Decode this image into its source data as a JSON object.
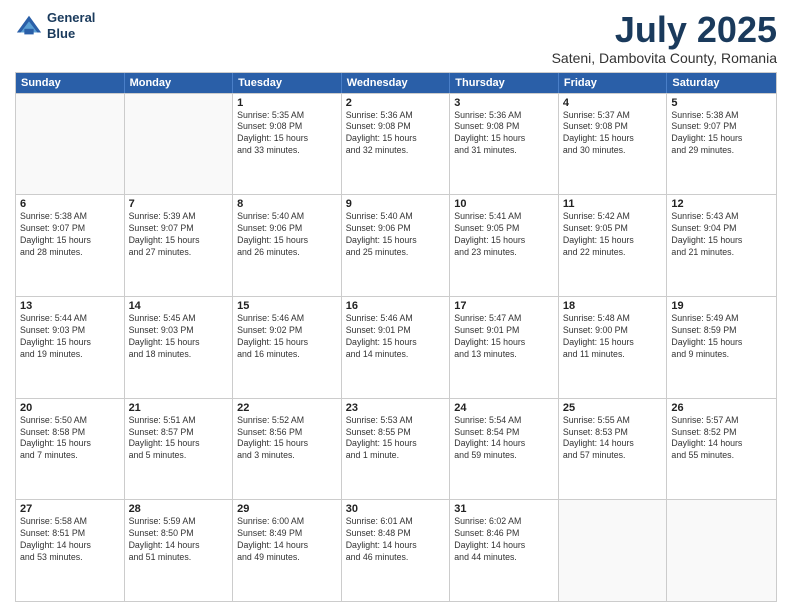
{
  "header": {
    "logo_line1": "General",
    "logo_line2": "Blue",
    "title": "July 2025",
    "subtitle": "Sateni, Dambovita County, Romania"
  },
  "days_of_week": [
    "Sunday",
    "Monday",
    "Tuesday",
    "Wednesday",
    "Thursday",
    "Friday",
    "Saturday"
  ],
  "weeks": [
    [
      {
        "day": "",
        "info": ""
      },
      {
        "day": "",
        "info": ""
      },
      {
        "day": "1",
        "info": "Sunrise: 5:35 AM\nSunset: 9:08 PM\nDaylight: 15 hours\nand 33 minutes."
      },
      {
        "day": "2",
        "info": "Sunrise: 5:36 AM\nSunset: 9:08 PM\nDaylight: 15 hours\nand 32 minutes."
      },
      {
        "day": "3",
        "info": "Sunrise: 5:36 AM\nSunset: 9:08 PM\nDaylight: 15 hours\nand 31 minutes."
      },
      {
        "day": "4",
        "info": "Sunrise: 5:37 AM\nSunset: 9:08 PM\nDaylight: 15 hours\nand 30 minutes."
      },
      {
        "day": "5",
        "info": "Sunrise: 5:38 AM\nSunset: 9:07 PM\nDaylight: 15 hours\nand 29 minutes."
      }
    ],
    [
      {
        "day": "6",
        "info": "Sunrise: 5:38 AM\nSunset: 9:07 PM\nDaylight: 15 hours\nand 28 minutes."
      },
      {
        "day": "7",
        "info": "Sunrise: 5:39 AM\nSunset: 9:07 PM\nDaylight: 15 hours\nand 27 minutes."
      },
      {
        "day": "8",
        "info": "Sunrise: 5:40 AM\nSunset: 9:06 PM\nDaylight: 15 hours\nand 26 minutes."
      },
      {
        "day": "9",
        "info": "Sunrise: 5:40 AM\nSunset: 9:06 PM\nDaylight: 15 hours\nand 25 minutes."
      },
      {
        "day": "10",
        "info": "Sunrise: 5:41 AM\nSunset: 9:05 PM\nDaylight: 15 hours\nand 23 minutes."
      },
      {
        "day": "11",
        "info": "Sunrise: 5:42 AM\nSunset: 9:05 PM\nDaylight: 15 hours\nand 22 minutes."
      },
      {
        "day": "12",
        "info": "Sunrise: 5:43 AM\nSunset: 9:04 PM\nDaylight: 15 hours\nand 21 minutes."
      }
    ],
    [
      {
        "day": "13",
        "info": "Sunrise: 5:44 AM\nSunset: 9:03 PM\nDaylight: 15 hours\nand 19 minutes."
      },
      {
        "day": "14",
        "info": "Sunrise: 5:45 AM\nSunset: 9:03 PM\nDaylight: 15 hours\nand 18 minutes."
      },
      {
        "day": "15",
        "info": "Sunrise: 5:46 AM\nSunset: 9:02 PM\nDaylight: 15 hours\nand 16 minutes."
      },
      {
        "day": "16",
        "info": "Sunrise: 5:46 AM\nSunset: 9:01 PM\nDaylight: 15 hours\nand 14 minutes."
      },
      {
        "day": "17",
        "info": "Sunrise: 5:47 AM\nSunset: 9:01 PM\nDaylight: 15 hours\nand 13 minutes."
      },
      {
        "day": "18",
        "info": "Sunrise: 5:48 AM\nSunset: 9:00 PM\nDaylight: 15 hours\nand 11 minutes."
      },
      {
        "day": "19",
        "info": "Sunrise: 5:49 AM\nSunset: 8:59 PM\nDaylight: 15 hours\nand 9 minutes."
      }
    ],
    [
      {
        "day": "20",
        "info": "Sunrise: 5:50 AM\nSunset: 8:58 PM\nDaylight: 15 hours\nand 7 minutes."
      },
      {
        "day": "21",
        "info": "Sunrise: 5:51 AM\nSunset: 8:57 PM\nDaylight: 15 hours\nand 5 minutes."
      },
      {
        "day": "22",
        "info": "Sunrise: 5:52 AM\nSunset: 8:56 PM\nDaylight: 15 hours\nand 3 minutes."
      },
      {
        "day": "23",
        "info": "Sunrise: 5:53 AM\nSunset: 8:55 PM\nDaylight: 15 hours\nand 1 minute."
      },
      {
        "day": "24",
        "info": "Sunrise: 5:54 AM\nSunset: 8:54 PM\nDaylight: 14 hours\nand 59 minutes."
      },
      {
        "day": "25",
        "info": "Sunrise: 5:55 AM\nSunset: 8:53 PM\nDaylight: 14 hours\nand 57 minutes."
      },
      {
        "day": "26",
        "info": "Sunrise: 5:57 AM\nSunset: 8:52 PM\nDaylight: 14 hours\nand 55 minutes."
      }
    ],
    [
      {
        "day": "27",
        "info": "Sunrise: 5:58 AM\nSunset: 8:51 PM\nDaylight: 14 hours\nand 53 minutes."
      },
      {
        "day": "28",
        "info": "Sunrise: 5:59 AM\nSunset: 8:50 PM\nDaylight: 14 hours\nand 51 minutes."
      },
      {
        "day": "29",
        "info": "Sunrise: 6:00 AM\nSunset: 8:49 PM\nDaylight: 14 hours\nand 49 minutes."
      },
      {
        "day": "30",
        "info": "Sunrise: 6:01 AM\nSunset: 8:48 PM\nDaylight: 14 hours\nand 46 minutes."
      },
      {
        "day": "31",
        "info": "Sunrise: 6:02 AM\nSunset: 8:46 PM\nDaylight: 14 hours\nand 44 minutes."
      },
      {
        "day": "",
        "info": ""
      },
      {
        "day": "",
        "info": ""
      }
    ]
  ]
}
